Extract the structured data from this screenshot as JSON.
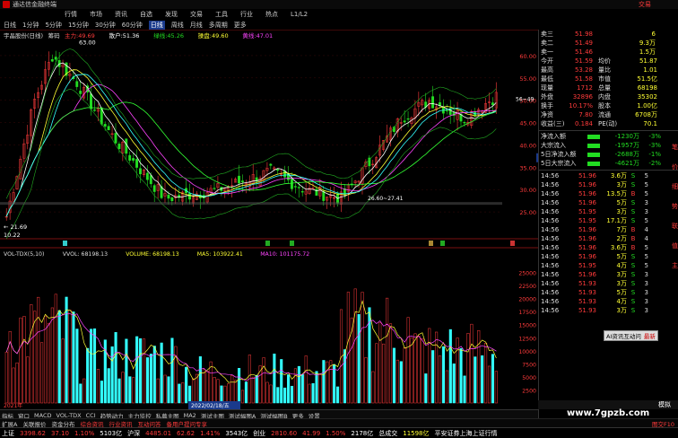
{
  "titlebar": {
    "app_title": "通达信金融终端",
    "menus": [
      "行情",
      "市场",
      "资讯",
      "自选",
      "发现",
      "交易",
      "工具",
      "行业",
      "热点",
      "L1/L2"
    ],
    "right_label": "交易"
  },
  "periods": {
    "items": [
      "日线",
      "1分钟",
      "5分钟",
      "15分钟",
      "30分钟",
      "60分钟",
      "日线",
      "周线",
      "月线",
      "多周期",
      "更多"
    ],
    "active_index": 6
  },
  "main_title": {
    "stock": "宇晶股份(日线)",
    "indicator": "筹码",
    "main_line": "主力:49.69",
    "sell_line": "散户:51.36",
    "green_line": "绿线:45.26",
    "cyan_line": "操盘:49.60",
    "yellow_line": "黄线:47.01"
  },
  "price_chart": {
    "high_label": "63.00",
    "low_label": "21.69",
    "low_date": "10.22",
    "ma_range_label": "26.60~27.41",
    "right_top_label": "56~49",
    "y_ticks": [
      "60.00",
      "55.00",
      "50.00",
      "45.00",
      "40.00",
      "35.00",
      "30.00",
      "25.00"
    ],
    "current_price_tag": "37.13"
  },
  "volume_chart": {
    "title": "VOL-TDX(5,10)",
    "vvol": "VVOL: 68198.13",
    "volume": "VOLUME: 68198.13",
    "ma5": "MA5: 103922.41",
    "ma10": "MA10: 101175.72",
    "y_ticks": [
      "25000",
      "22500",
      "20000",
      "17500",
      "15000",
      "12500",
      "10000",
      "7500",
      "5000",
      "2500"
    ],
    "date_label": "2022/02/18/五",
    "x_start": "2021年"
  },
  "quote_panel": {
    "rows": [
      {
        "label": "卖三",
        "price": "51.98",
        "vol": "6"
      },
      {
        "label": "卖二",
        "price": "51.49",
        "vol": "9.3万"
      },
      {
        "label": "卖一",
        "price": "51.46",
        "vol": "1.5万"
      },
      {
        "label": "今开",
        "price": "51.59",
        "k2": "均价",
        "v2": "51.87"
      },
      {
        "label": "最高",
        "price": "53.28",
        "k2": "量比",
        "v2": "1.01"
      },
      {
        "label": "最低",
        "price": "51.58",
        "k2": "市值",
        "v2": "51.5亿"
      },
      {
        "label": "现量",
        "price": "1712",
        "k2": "总量",
        "v2": "68198"
      },
      {
        "label": "外盘",
        "price": "32896",
        "k2": "内盘",
        "v2": "35302"
      },
      {
        "label": "换手",
        "price": "10.17%",
        "k2": "股本",
        "v2": "1.00亿"
      },
      {
        "label": "净资",
        "price": "7.80",
        "k2": "流通",
        "v2": "6708万"
      },
      {
        "label": "收益(三)",
        "price": "0.184",
        "k2": "PE(动)",
        "v2": "70.1"
      }
    ],
    "flows": [
      {
        "label": "净流入额",
        "value": "-1230万",
        "pct": "-3%"
      },
      {
        "label": "大宗流入",
        "value": "-1957万",
        "pct": "-3%"
      },
      {
        "label": "5日净流入额",
        "value": "-2688万",
        "pct": "-1%"
      },
      {
        "label": "5日大宗流入",
        "value": "-4621万",
        "pct": "-2%"
      }
    ],
    "ticks": [
      {
        "time": "14:56",
        "price": "51.96",
        "vol": "3.6万",
        "side": "S",
        "n": "5"
      },
      {
        "time": "14:56",
        "price": "51.96",
        "vol": "3万",
        "side": "S",
        "n": "5"
      },
      {
        "time": "14:56",
        "price": "51.96",
        "vol": "13.5万",
        "side": "B",
        "n": "5"
      },
      {
        "time": "14:56",
        "price": "51.96",
        "vol": "5万",
        "side": "S",
        "n": "3"
      },
      {
        "time": "14:56",
        "price": "51.95",
        "vol": "3万",
        "side": "S",
        "n": "3"
      },
      {
        "time": "14:56",
        "price": "51.95",
        "vol": "17.1万",
        "side": "S",
        "n": "5"
      },
      {
        "time": "14:56",
        "price": "51.96",
        "vol": "7万",
        "side": "B",
        "n": "4"
      },
      {
        "time": "14:56",
        "price": "51.96",
        "vol": "2万",
        "side": "B",
        "n": "4"
      },
      {
        "time": "14:56",
        "price": "51.96",
        "vol": "3.6万",
        "side": "B",
        "n": "5"
      },
      {
        "time": "14:56",
        "price": "51.96",
        "vol": "5万",
        "side": "S",
        "n": "5"
      },
      {
        "time": "14:56",
        "price": "51.95",
        "vol": "4万",
        "side": "S",
        "n": "5"
      },
      {
        "time": "14:56",
        "price": "51.96",
        "vol": "3万",
        "side": "S",
        "n": "3"
      },
      {
        "time": "14:56",
        "price": "51.93",
        "vol": "3万",
        "side": "S",
        "n": "3"
      },
      {
        "time": "14:56",
        "price": "51.93",
        "vol": "5万",
        "side": "S",
        "n": "3"
      },
      {
        "time": "14:56",
        "price": "51.93",
        "vol": "4万",
        "side": "S",
        "n": "3"
      },
      {
        "time": "14:56",
        "price": "51.93",
        "vol": "3万",
        "side": "S",
        "n": "3"
      }
    ],
    "popup": "AI资讯互动问",
    "popup2": "最新",
    "rp_tabs": [
      "笔",
      "价",
      "细",
      "势",
      "联",
      "值",
      "主"
    ],
    "bottom_label": "模拟"
  },
  "bottom_tabs": [
    "指标",
    "窗口",
    "MACD",
    "VOL-TDX",
    "CCI",
    "趋势动力",
    "主力监控",
    "私募主图",
    "MA2",
    "测试主图",
    "测试幅图A",
    "测试幅图B",
    "更多",
    "设置"
  ],
  "sub_tabs": [
    "扩展A",
    "关联报价",
    "资金分布",
    "综合资讯",
    "行业资讯",
    "互动问答",
    "备用户提问专享"
  ],
  "status": {
    "sh_label": "上证",
    "sh_val": "3398.62",
    "sh_chg": "37.10",
    "sh_pct": "1.10%",
    "sh_amt": "5103亿",
    "sz_label": "沪深",
    "sz_val": "4485.01",
    "sz_chg": "62.62",
    "sz_pct": "1.41%",
    "sz_amt": "3543亿",
    "cy_label": "创业",
    "cy_val": "2810.60",
    "cy_chg": "41.99",
    "cy_pct": "1.50%",
    "cy_amt": "2178亿",
    "total_label": "总成交",
    "total_val": "11598亿",
    "right_text": "平安证券上海上证行情",
    "corner": "图交F10"
  },
  "watermark": "www.7gpzb.com",
  "colors": {
    "up": "#ff3b3b",
    "down": "#22dd22",
    "cyan": "#33ffff",
    "magenta": "#ff44ff",
    "yellow": "#ffff33"
  }
}
